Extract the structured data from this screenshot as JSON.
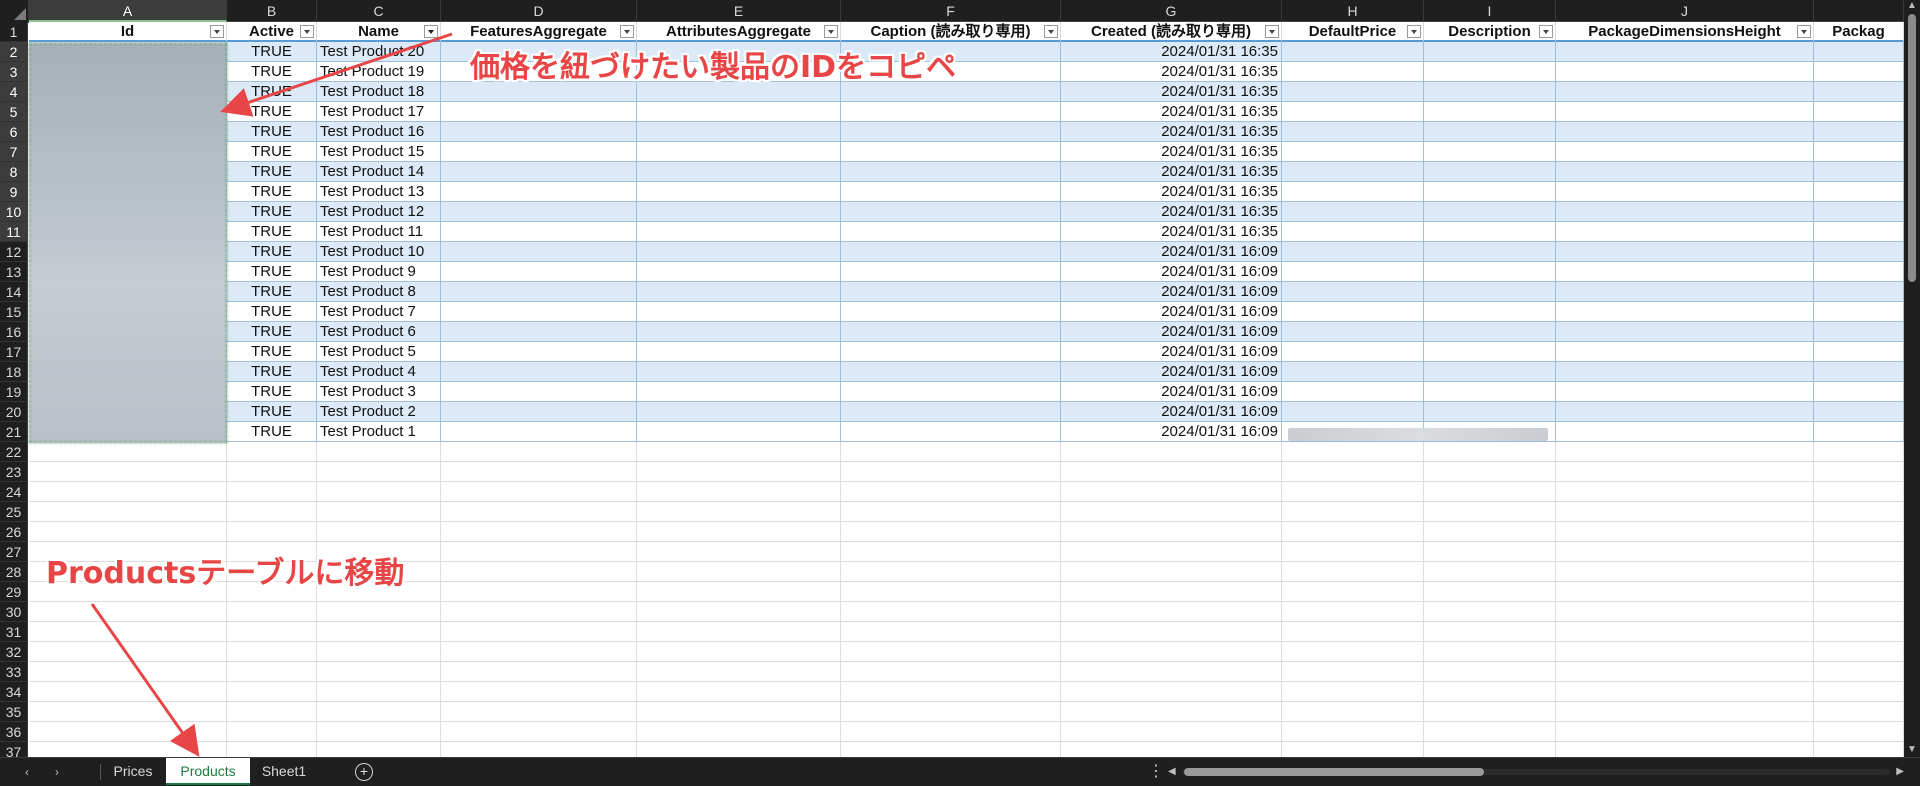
{
  "column_letters": [
    "A",
    "B",
    "C",
    "D",
    "E",
    "F",
    "G",
    "H",
    "I",
    "J",
    ""
  ],
  "header_row": [
    "Id",
    "Active",
    "Name",
    "FeaturesAggregate",
    "AttributesAggregate",
    "Caption (読み取り専用)",
    "Created (読み取り専用)",
    "DefaultPrice",
    "Description",
    "PackageDimensionsHeight",
    "Packag"
  ],
  "row_numbers": [
    "1",
    "2",
    "3",
    "4",
    "5",
    "6",
    "7",
    "8",
    "9",
    "10",
    "11",
    "12",
    "13",
    "14",
    "15",
    "16",
    "17",
    "18",
    "19",
    "20",
    "21",
    "22",
    "23",
    "24",
    "25",
    "26",
    "27",
    "28",
    "29",
    "30",
    "31",
    "32",
    "33",
    "34",
    "35",
    "36",
    "37"
  ],
  "rows": [
    {
      "active": "TRUE",
      "name": "Test Product 20",
      "created": "2024/01/31 16:35"
    },
    {
      "active": "TRUE",
      "name": "Test Product 19",
      "created": "2024/01/31 16:35"
    },
    {
      "active": "TRUE",
      "name": "Test Product 18",
      "created": "2024/01/31 16:35"
    },
    {
      "active": "TRUE",
      "name": "Test Product 17",
      "created": "2024/01/31 16:35"
    },
    {
      "active": "TRUE",
      "name": "Test Product 16",
      "created": "2024/01/31 16:35"
    },
    {
      "active": "TRUE",
      "name": "Test Product 15",
      "created": "2024/01/31 16:35"
    },
    {
      "active": "TRUE",
      "name": "Test Product 14",
      "created": "2024/01/31 16:35"
    },
    {
      "active": "TRUE",
      "name": "Test Product 13",
      "created": "2024/01/31 16:35"
    },
    {
      "active": "TRUE",
      "name": "Test Product 12",
      "created": "2024/01/31 16:35"
    },
    {
      "active": "TRUE",
      "name": "Test Product 11",
      "created": "2024/01/31 16:35"
    },
    {
      "active": "TRUE",
      "name": "Test Product 10",
      "created": "2024/01/31 16:09"
    },
    {
      "active": "TRUE",
      "name": "Test Product 9",
      "created": "2024/01/31 16:09"
    },
    {
      "active": "TRUE",
      "name": "Test Product 8",
      "created": "2024/01/31 16:09"
    },
    {
      "active": "TRUE",
      "name": "Test Product 7",
      "created": "2024/01/31 16:09"
    },
    {
      "active": "TRUE",
      "name": "Test Product 6",
      "created": "2024/01/31 16:09"
    },
    {
      "active": "TRUE",
      "name": "Test Product 5",
      "created": "2024/01/31 16:09"
    },
    {
      "active": "TRUE",
      "name": "Test Product 4",
      "created": "2024/01/31 16:09"
    },
    {
      "active": "TRUE",
      "name": "Test Product 3",
      "created": "2024/01/31 16:09"
    },
    {
      "active": "TRUE",
      "name": "Test Product 2",
      "created": "2024/01/31 16:09"
    },
    {
      "active": "TRUE",
      "name": "Test Product 1",
      "created": "2024/01/31 16:09"
    }
  ],
  "annotations": {
    "copy_ids": "価格を紐づけたい製品のIDをコピペ",
    "move_table": "Productsテーブルに移動"
  },
  "sheet_tabs": [
    {
      "label": "Prices",
      "active": false
    },
    {
      "label": "Products",
      "active": true
    },
    {
      "label": "Sheet1",
      "active": false
    }
  ],
  "controls": {
    "nav_prev": "‹",
    "nav_next": "›",
    "add_sheet": "+",
    "more_options": "⋮",
    "scroll_left": "◀",
    "scroll_right": "▶",
    "scroll_up": "▲",
    "scroll_down": "▼"
  },
  "colors": {
    "table_band": "#dce9f6",
    "table_border": "#5b9bd5",
    "annotation": "#e84646",
    "active_tab": "#1e7a3c",
    "chrome_dark": "#1f1f1f"
  },
  "icons": [
    "filter-dropdown-icon",
    "sort-filter-icon",
    "add-sheet-icon",
    "arrow-annotation"
  ]
}
